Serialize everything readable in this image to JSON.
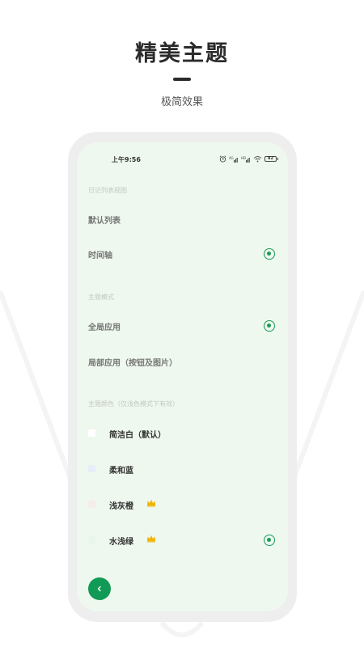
{
  "promo": {
    "title": "精美主题",
    "subtitle": "极简效果"
  },
  "status_bar": {
    "time": "上午9:56",
    "battery": "82",
    "icons": [
      "alarm-icon",
      "signal-icon",
      "signal-icon",
      "wifi-icon",
      "battery-icon"
    ]
  },
  "diary_list_view": {
    "header": "日记列表视图",
    "options": [
      {
        "label": "默认列表",
        "selected": false
      },
      {
        "label": "时间轴",
        "selected": true
      }
    ]
  },
  "theme_mode": {
    "header": "主题模式",
    "options": [
      {
        "label": "全局应用",
        "selected": true
      },
      {
        "label": "局部应用（按钮及图片）",
        "selected": false
      }
    ]
  },
  "theme_color": {
    "header": "主题颜色（仅浅色模式下有效）",
    "options": [
      {
        "label": "简洁白（默认）",
        "swatch": "#ffffff",
        "premium": false,
        "selected": false
      },
      {
        "label": "柔和蓝",
        "swatch": "#e9edf9",
        "premium": false,
        "selected": false
      },
      {
        "label": "浅灰橙",
        "swatch": "#f6ece9",
        "premium": true,
        "selected": false
      },
      {
        "label": "水浅绿",
        "swatch": "#e8f5e9",
        "premium": true,
        "selected": true
      }
    ]
  },
  "colors": {
    "accent": "#1e9a5a",
    "back_button": "#119a56",
    "screen_bg": "#eef8ee",
    "crown": "#f0b400"
  }
}
